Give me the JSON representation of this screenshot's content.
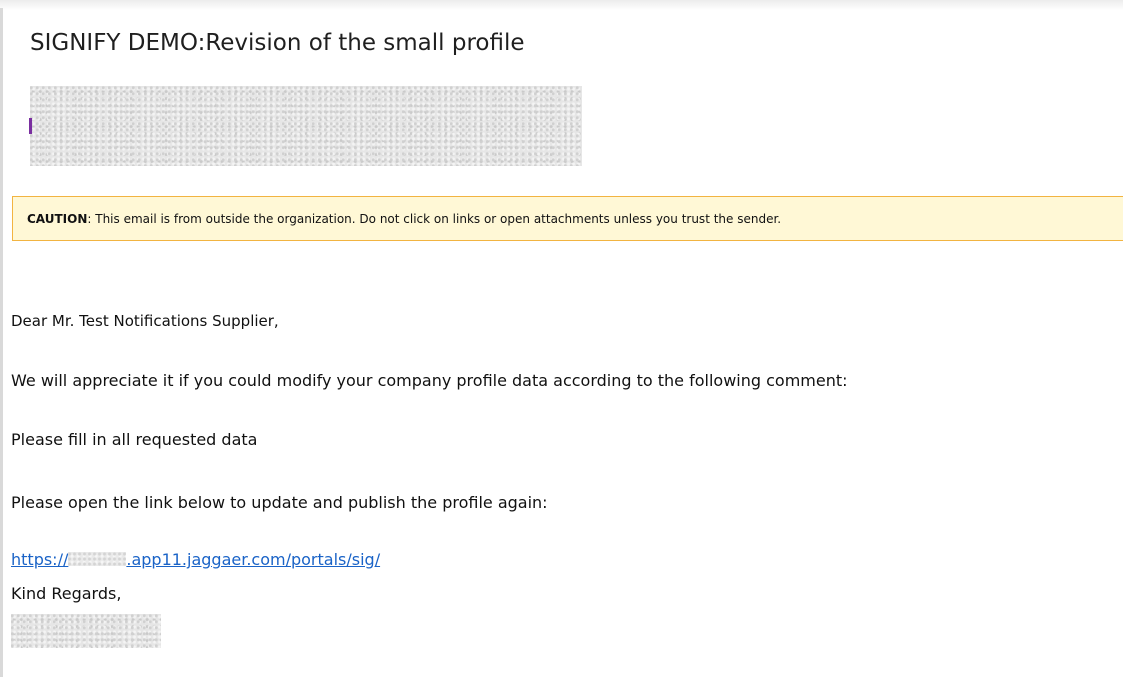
{
  "email": {
    "subject": "SIGNIFY DEMO:Revision of the small profile",
    "caution": {
      "label": "CAUTION",
      "message": ": This email is from outside the organization. Do not click on links or open attachments unless you trust the sender."
    },
    "greeting": "Dear Mr. Test Notifications Supplier,",
    "request": "We will appreciate it if you could modify your company profile data according to the following comment:",
    "comment": "Please fill in all requested data",
    "instruction": "Please open the link below to update and publish the profile again:",
    "link": {
      "prefix": "https://",
      "suffix": ".app11.jaggaer.com/portals/sig/"
    },
    "closing": "Kind Regards,"
  },
  "colors": {
    "link": "#1a63c7",
    "caution_background": "#fff8d6",
    "caution_border": "#f2b441",
    "sender_accent": "#7a2fa0"
  }
}
